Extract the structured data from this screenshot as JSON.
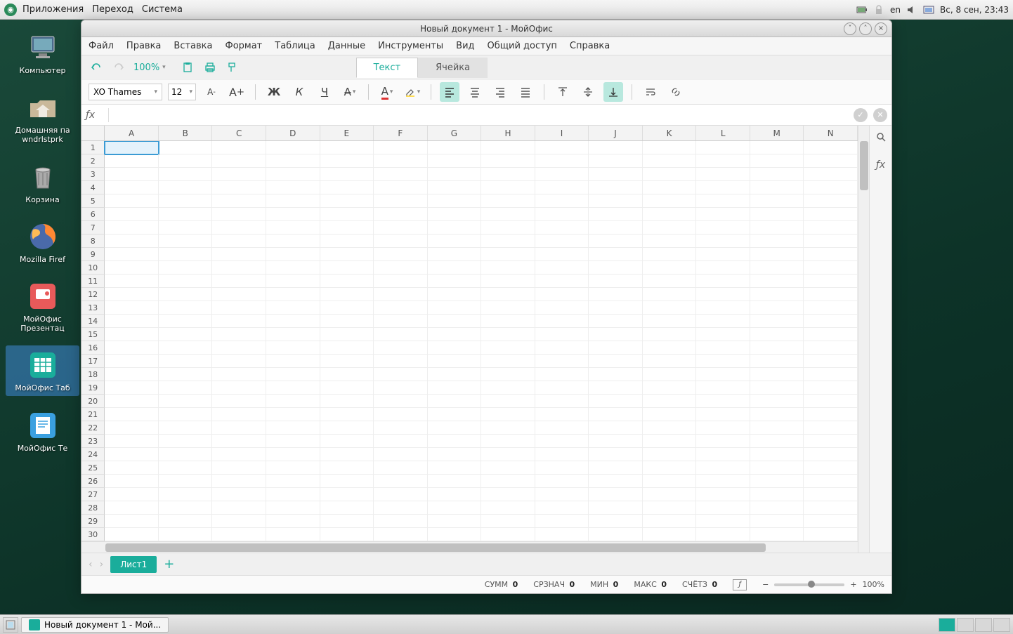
{
  "system_bar": {
    "menus": [
      "Приложения",
      "Переход",
      "Система"
    ],
    "lang": "en",
    "clock": "Вс,  8 сен, 23:43"
  },
  "desktop_icons": [
    {
      "id": "computer",
      "label": "Компьютер"
    },
    {
      "id": "home",
      "label": "Домашняя па\nwndrlstprk"
    },
    {
      "id": "trash",
      "label": "Корзина"
    },
    {
      "id": "firefox",
      "label": "Mozilla Firef"
    },
    {
      "id": "present",
      "label": "МойОфис\nПрезентац"
    },
    {
      "id": "table",
      "label": "МойОфис Таб",
      "selected": true
    },
    {
      "id": "text",
      "label": "МойОфис Те"
    }
  ],
  "window": {
    "title": "Новый документ 1 - МойОфис",
    "menu": [
      "Файл",
      "Правка",
      "Вставка",
      "Формат",
      "Таблица",
      "Данные",
      "Инструменты",
      "Вид",
      "Общий доступ",
      "Справка"
    ],
    "zoom": "100%",
    "tabs": {
      "active": "Текст",
      "inactive": "Ячейка"
    },
    "font": "XO Thames",
    "font_size": "12",
    "columns": [
      "A",
      "B",
      "C",
      "D",
      "E",
      "F",
      "G",
      "H",
      "I",
      "J",
      "K",
      "L",
      "M",
      "N"
    ],
    "rows": 30,
    "selected_cell": "A1",
    "sheet": "Лист1",
    "status": {
      "sum_label": "СУММ",
      "sum": "0",
      "avg_label": "СРЗНАЧ",
      "avg": "0",
      "min_label": "МИН",
      "min": "0",
      "max_label": "МАКС",
      "max": "0",
      "count_label": "СЧЁТЗ",
      "count": "0",
      "zoom": "100%"
    }
  },
  "taskbar": {
    "app": "Новый документ 1 - Мой..."
  }
}
